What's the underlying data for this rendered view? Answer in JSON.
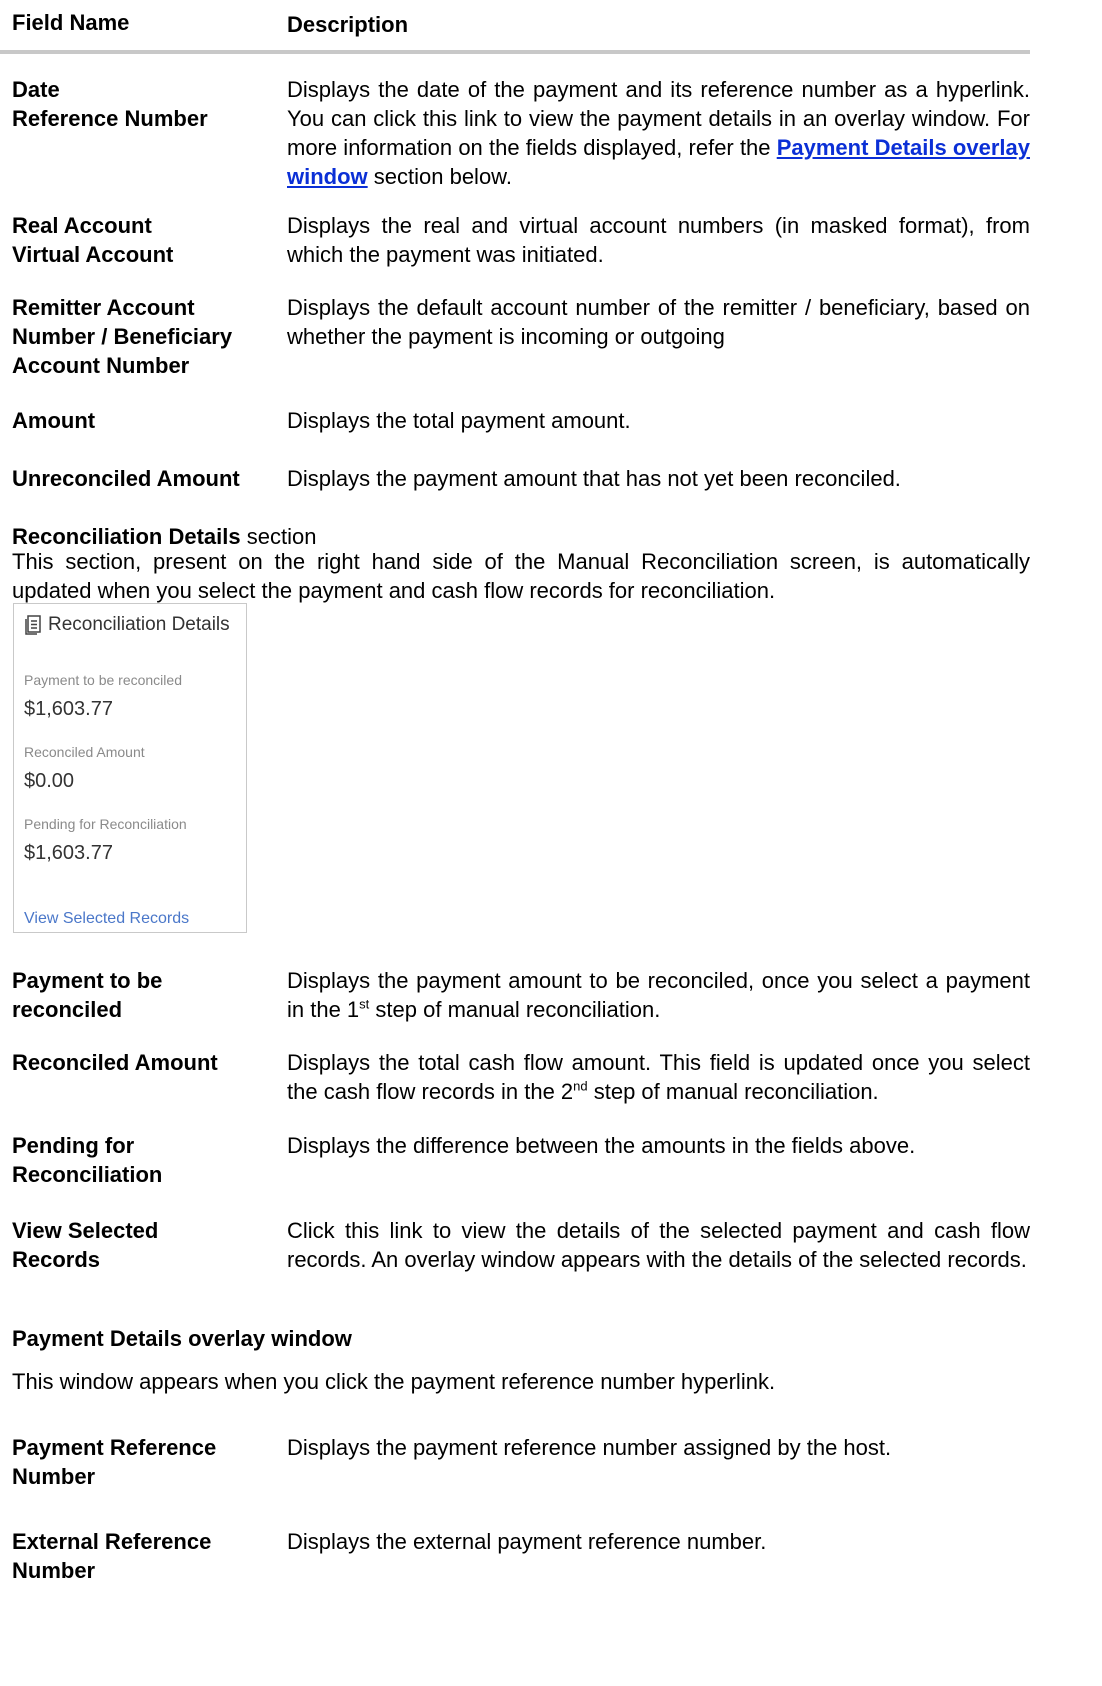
{
  "table_header": {
    "field_name": "Field Name",
    "description": "Description"
  },
  "rows_1": [
    {
      "name": [
        "Date",
        "Reference Number"
      ],
      "desc_before": "Displays the date of the payment and its reference number as a hyperlink. You can click this link to view the payment details in an overlay window. For more information on the fields displayed, refer the ",
      "desc_link": "Payment Details overlay window",
      "desc_after": " section below."
    },
    {
      "name": [
        "Real Account",
        "Virtual Account"
      ],
      "desc": "Displays the real and virtual account numbers (in masked format), from which the payment was initiated."
    },
    {
      "name": [
        "Remitter Account",
        "Number / Beneficiary",
        "Account Number"
      ],
      "desc": "Displays the default account number of the remitter / beneficiary, based on whether the payment is incoming or outgoing"
    },
    {
      "name": [
        "Amount"
      ],
      "desc": "Displays the total payment amount."
    },
    {
      "name": [
        "Unreconciled Amount"
      ],
      "desc": "Displays the payment amount that has not yet been reconciled."
    }
  ],
  "section1": {
    "heading_bold": "Reconciliation Details",
    "heading_rest": " section",
    "para": "This section, present on the right hand side of the Manual Reconciliation screen, is automatically updated when you select the payment and cash flow records for reconciliation."
  },
  "widget": {
    "icon": "document-list-icon",
    "title": "Reconciliation Details",
    "items": [
      {
        "label": "Payment to be reconciled",
        "value": "$1,603.77"
      },
      {
        "label": "Reconciled Amount",
        "value": "$0.00"
      },
      {
        "label": "Pending for Reconciliation",
        "value": "$1,603.77"
      }
    ],
    "link": "View Selected Records",
    "link_color": "#4a77c9"
  },
  "rows_2": {
    "payment_to_be_reconciled": {
      "name": [
        "Payment to be",
        "reconciled"
      ],
      "d1": "Displays the payment amount to be reconciled, once you select a payment in the 1",
      "sup": "st",
      "d2": " step of manual reconciliation."
    },
    "reconciled_amount": {
      "name": [
        "Reconciled Amount"
      ],
      "d1": "Displays the total cash flow amount. This field is updated once you select the cash flow records in the 2",
      "sup": "nd",
      "d2": " step of manual reconciliation."
    },
    "pending": {
      "name": [
        "Pending for",
        "Reconciliation"
      ],
      "desc": "Displays the difference between the amounts in the fields above."
    },
    "view_selected": {
      "name": [
        "View Selected",
        "Records"
      ],
      "desc": "Click this link to view the details of the selected payment and cash flow records. An overlay window appears with the details of the selected records."
    }
  },
  "section2": {
    "heading": "Payment Details overlay window",
    "para": "This window appears when you click the payment reference number hyperlink."
  },
  "rows_3": [
    {
      "name": [
        "Payment Reference",
        "Number"
      ],
      "desc": "Displays the payment reference number assigned by the host."
    },
    {
      "name": [
        "External Reference",
        "Number"
      ],
      "desc": "Displays the external payment reference number."
    }
  ],
  "colors": {
    "link": "#0b2fd6",
    "rule": "#c8c8c8"
  }
}
